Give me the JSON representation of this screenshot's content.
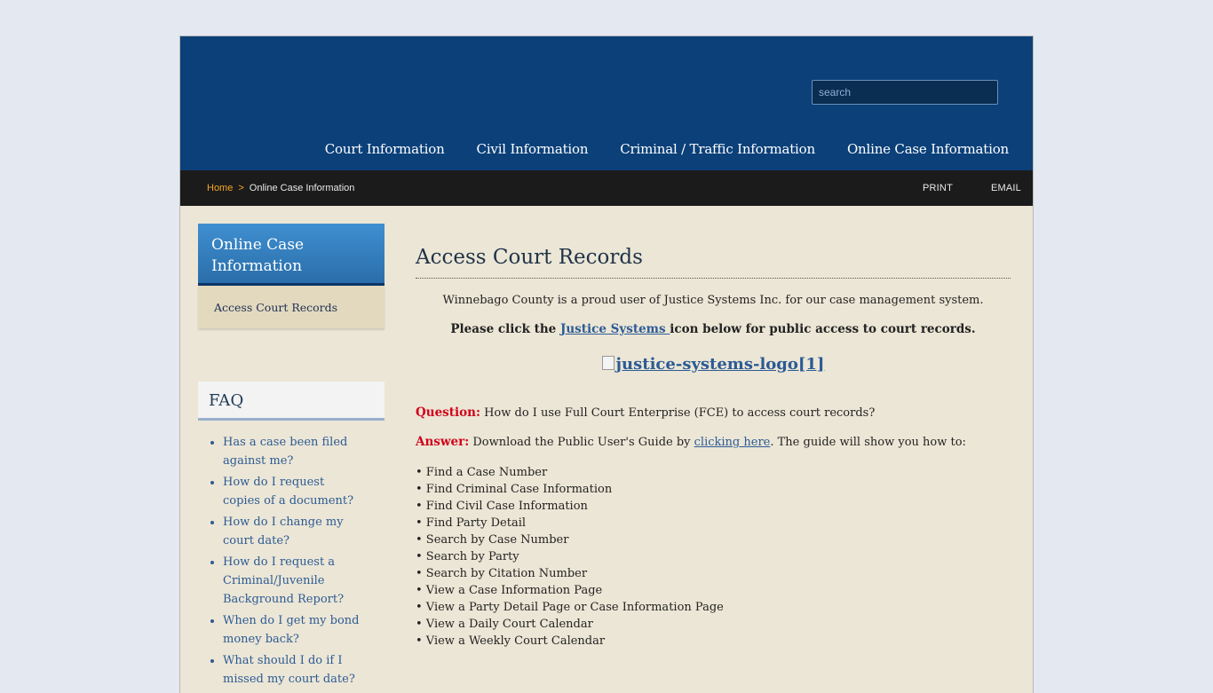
{
  "header": {
    "search_placeholder": "search",
    "nav": [
      "Court Information",
      "Civil Information",
      "Criminal / Traffic Information",
      "Online Case Information"
    ]
  },
  "breadcrumb": {
    "home": "Home",
    "separator": ">",
    "current": "Online Case Information",
    "print": "PRINT",
    "email": "EMAIL"
  },
  "sidebar": {
    "title": "Online Case Information",
    "item": "Access Court Records",
    "faq_title": "FAQ",
    "faq": [
      "Has a case been filed against me?",
      "How do I request copies of a document?",
      "How do I change my court date?",
      "How do I request a Criminal/Juvenile Background Report?",
      "When do I get my bond money back?",
      "What should I do if I missed my court date?"
    ]
  },
  "content": {
    "title": "Access Court Records",
    "intro": "Winnebago County is a proud user of Justice Systems Inc. for our case management system.",
    "click_pre": "Please click the ",
    "click_link": "Justice Systems ",
    "click_post": "icon below for public access to court records.",
    "logo_alt": "justice-systems-logo[1]",
    "question_label": "Question:",
    "question": " How do I use Full Court Enterprise (FCE) to access court records?",
    "answer_label": "Answer:",
    "answer_pre": " Download the Public User's Guide by ",
    "answer_link": "clicking here",
    "answer_post": ". The guide will show you how to:",
    "bullets": [
      "• Find a Case Number",
      "• Find Criminal Case Information",
      "• Find Civil Case Information",
      "• Find Party Detail",
      "• Search by Case Number",
      "• Search by Party",
      "• Search by Citation Number",
      "• View a Case Information Page",
      "• View a Party Detail Page or Case Information Page",
      "• View a Daily Court Calendar",
      "• View a Weekly Court Calendar"
    ]
  }
}
